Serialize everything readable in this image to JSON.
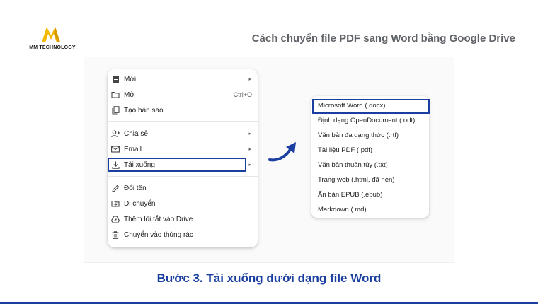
{
  "brand": {
    "name": "MM TECHNOLOGY",
    "accent": "#f5b800"
  },
  "header": {
    "title": "Cách chuyển file PDF sang Word bằng Google Drive"
  },
  "menu": {
    "items": [
      {
        "label": "Mới",
        "icon": "doc-icon",
        "submenu": true
      },
      {
        "label": "Mở",
        "icon": "folder-icon",
        "shortcut": "Ctrl+O"
      },
      {
        "label": "Tạo bản sao",
        "icon": "copy-icon"
      },
      {
        "label": "Chia sẻ",
        "icon": "share-person-icon",
        "submenu": true
      },
      {
        "label": "Email",
        "icon": "mail-icon",
        "submenu": true
      },
      {
        "label": "Tải xuống",
        "icon": "download-icon",
        "submenu": true
      },
      {
        "label": "Đổi tên",
        "icon": "pencil-icon"
      },
      {
        "label": "Di chuyển",
        "icon": "move-folder-icon"
      },
      {
        "label": "Thêm lối tắt vào Drive",
        "icon": "drive-shortcut-icon"
      },
      {
        "label": "Chuyển vào thùng rác",
        "icon": "trash-icon"
      }
    ]
  },
  "submenu": {
    "items": [
      "Microsoft Word (.docx)",
      "Định dạng OpenDocument (.odt)",
      "Văn bản đa dạng thức (.rtf)",
      "Tài liệu PDF (.pdf)",
      "Văn bản thuần túy (.txt)",
      "Trang web (.html, đã nén)",
      "Ấn bản EPUB (.epub)",
      "Markdown (.md)"
    ]
  },
  "caption": "Bước 3. Tải xuống dưới dạng file Word",
  "colors": {
    "highlight": "#1b3fa0",
    "caption": "#1b3fa0"
  }
}
